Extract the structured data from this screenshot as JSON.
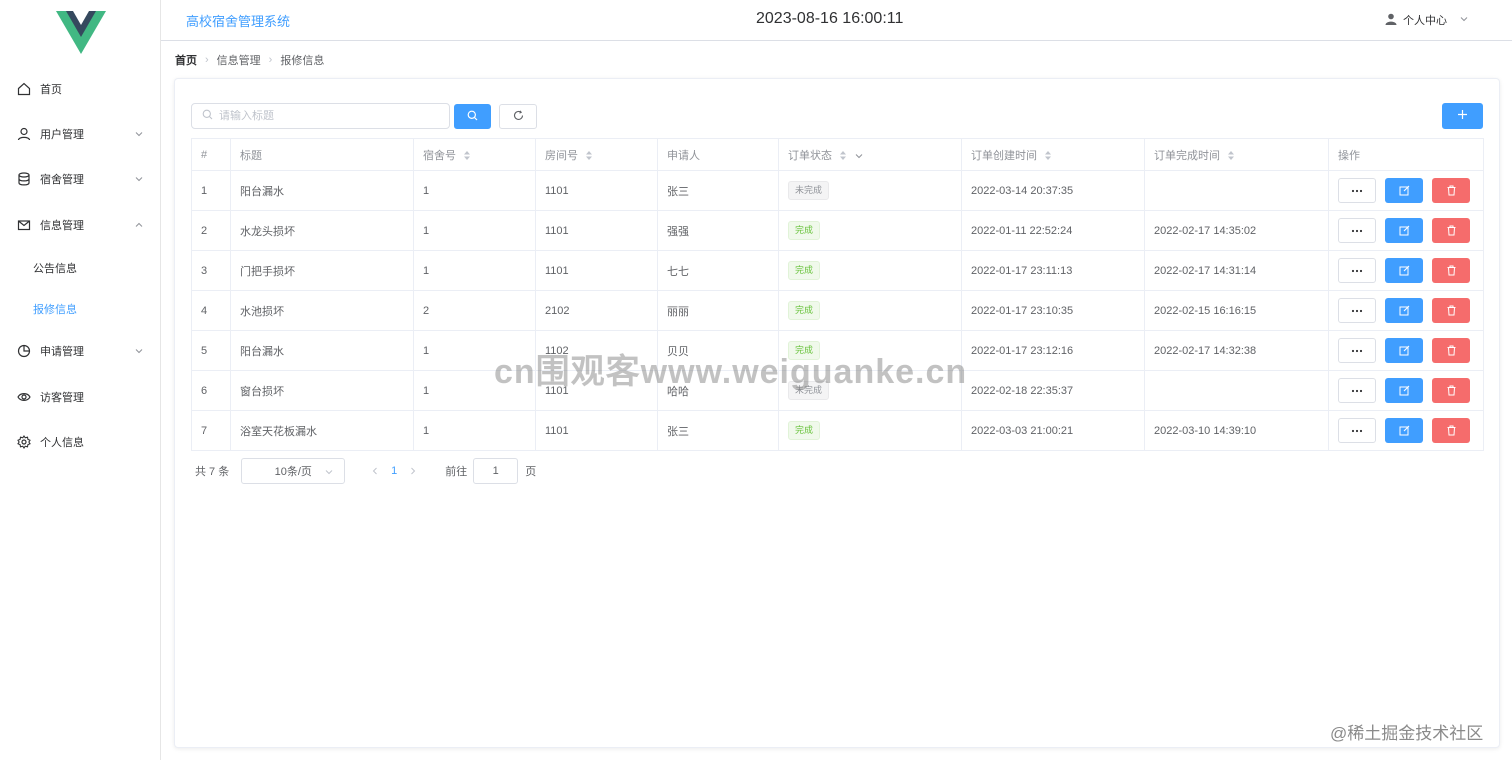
{
  "app": {
    "title": "高校宿舍管理系统",
    "clock": "2023-08-16 16:00:11",
    "user_menu": "个人中心"
  },
  "colors": {
    "accent": "#409eff",
    "success": "#67c23a",
    "danger": "#f56c6c",
    "logo_outer": "#41b883",
    "logo_inner": "#35495e"
  },
  "sidebar": {
    "items": [
      {
        "label": "首页",
        "icon": "home-icon"
      },
      {
        "label": "用户管理",
        "icon": "user-icon",
        "arrow": "chevron-down-icon"
      },
      {
        "label": "宿舍管理",
        "icon": "database-icon",
        "arrow": "chevron-down-icon"
      },
      {
        "label": "信息管理",
        "icon": "message-icon",
        "arrow": "chevron-up-icon"
      },
      {
        "label": "申请管理",
        "icon": "pie-chart-icon",
        "arrow": "chevron-down-icon"
      },
      {
        "label": "访客管理",
        "icon": "eye-icon"
      },
      {
        "label": "个人信息",
        "icon": "gear-icon"
      }
    ],
    "subitems": [
      {
        "label": "公告信息"
      },
      {
        "label": "报修信息",
        "active": true
      }
    ]
  },
  "breadcrumb": {
    "items": [
      "首页",
      "信息管理",
      "报修信息"
    ]
  },
  "search": {
    "placeholder": "请输入标题",
    "value": ""
  },
  "table": {
    "headers": [
      "#",
      "标题",
      "宿舍号",
      "房间号",
      "申请人",
      "订单状态",
      "订单创建时间",
      "订单完成时间",
      "操作"
    ],
    "rows": [
      {
        "no": "1",
        "title": "阳台漏水",
        "dorm": "1",
        "room": "1101",
        "applicant": "张三",
        "status": "未完成",
        "status_type": "undone",
        "created": "2022-03-14 20:37:35",
        "finished": ""
      },
      {
        "no": "2",
        "title": "水龙头损坏",
        "dorm": "1",
        "room": "1101",
        "applicant": "强强",
        "status": "完成",
        "status_type": "done",
        "created": "2022-01-11 22:52:24",
        "finished": "2022-02-17 14:35:02"
      },
      {
        "no": "3",
        "title": "门把手损坏",
        "dorm": "1",
        "room": "1101",
        "applicant": "七七",
        "status": "完成",
        "status_type": "done",
        "created": "2022-01-17 23:11:13",
        "finished": "2022-02-17 14:31:14"
      },
      {
        "no": "4",
        "title": "水池损坏",
        "dorm": "2",
        "room": "2102",
        "applicant": "丽丽",
        "status": "完成",
        "status_type": "done",
        "created": "2022-01-17 23:10:35",
        "finished": "2022-02-15 16:16:15"
      },
      {
        "no": "5",
        "title": "阳台漏水",
        "dorm": "1",
        "room": "1102",
        "applicant": "贝贝",
        "status": "完成",
        "status_type": "done",
        "created": "2022-01-17 23:12:16",
        "finished": "2022-02-17 14:32:38"
      },
      {
        "no": "6",
        "title": "窗台损坏",
        "dorm": "1",
        "room": "1101",
        "applicant": "哈哈",
        "status": "未完成",
        "status_type": "undone",
        "created": "2022-02-18 22:35:37",
        "finished": ""
      },
      {
        "no": "7",
        "title": "浴室天花板漏水",
        "dorm": "1",
        "room": "1101",
        "applicant": "张三",
        "status": "完成",
        "status_type": "done",
        "created": "2022-03-03 21:00:21",
        "finished": "2022-03-10 14:39:10"
      }
    ]
  },
  "pagination": {
    "total_text": "共 7 条",
    "page_size": "10条/页",
    "current_page": "1",
    "jump_label": "前往",
    "jump_value": "1",
    "jump_suffix": "页"
  },
  "watermarks": {
    "center": "cn围观客www.weiguanke.cn",
    "corner": "@稀土掘金技术社区"
  }
}
